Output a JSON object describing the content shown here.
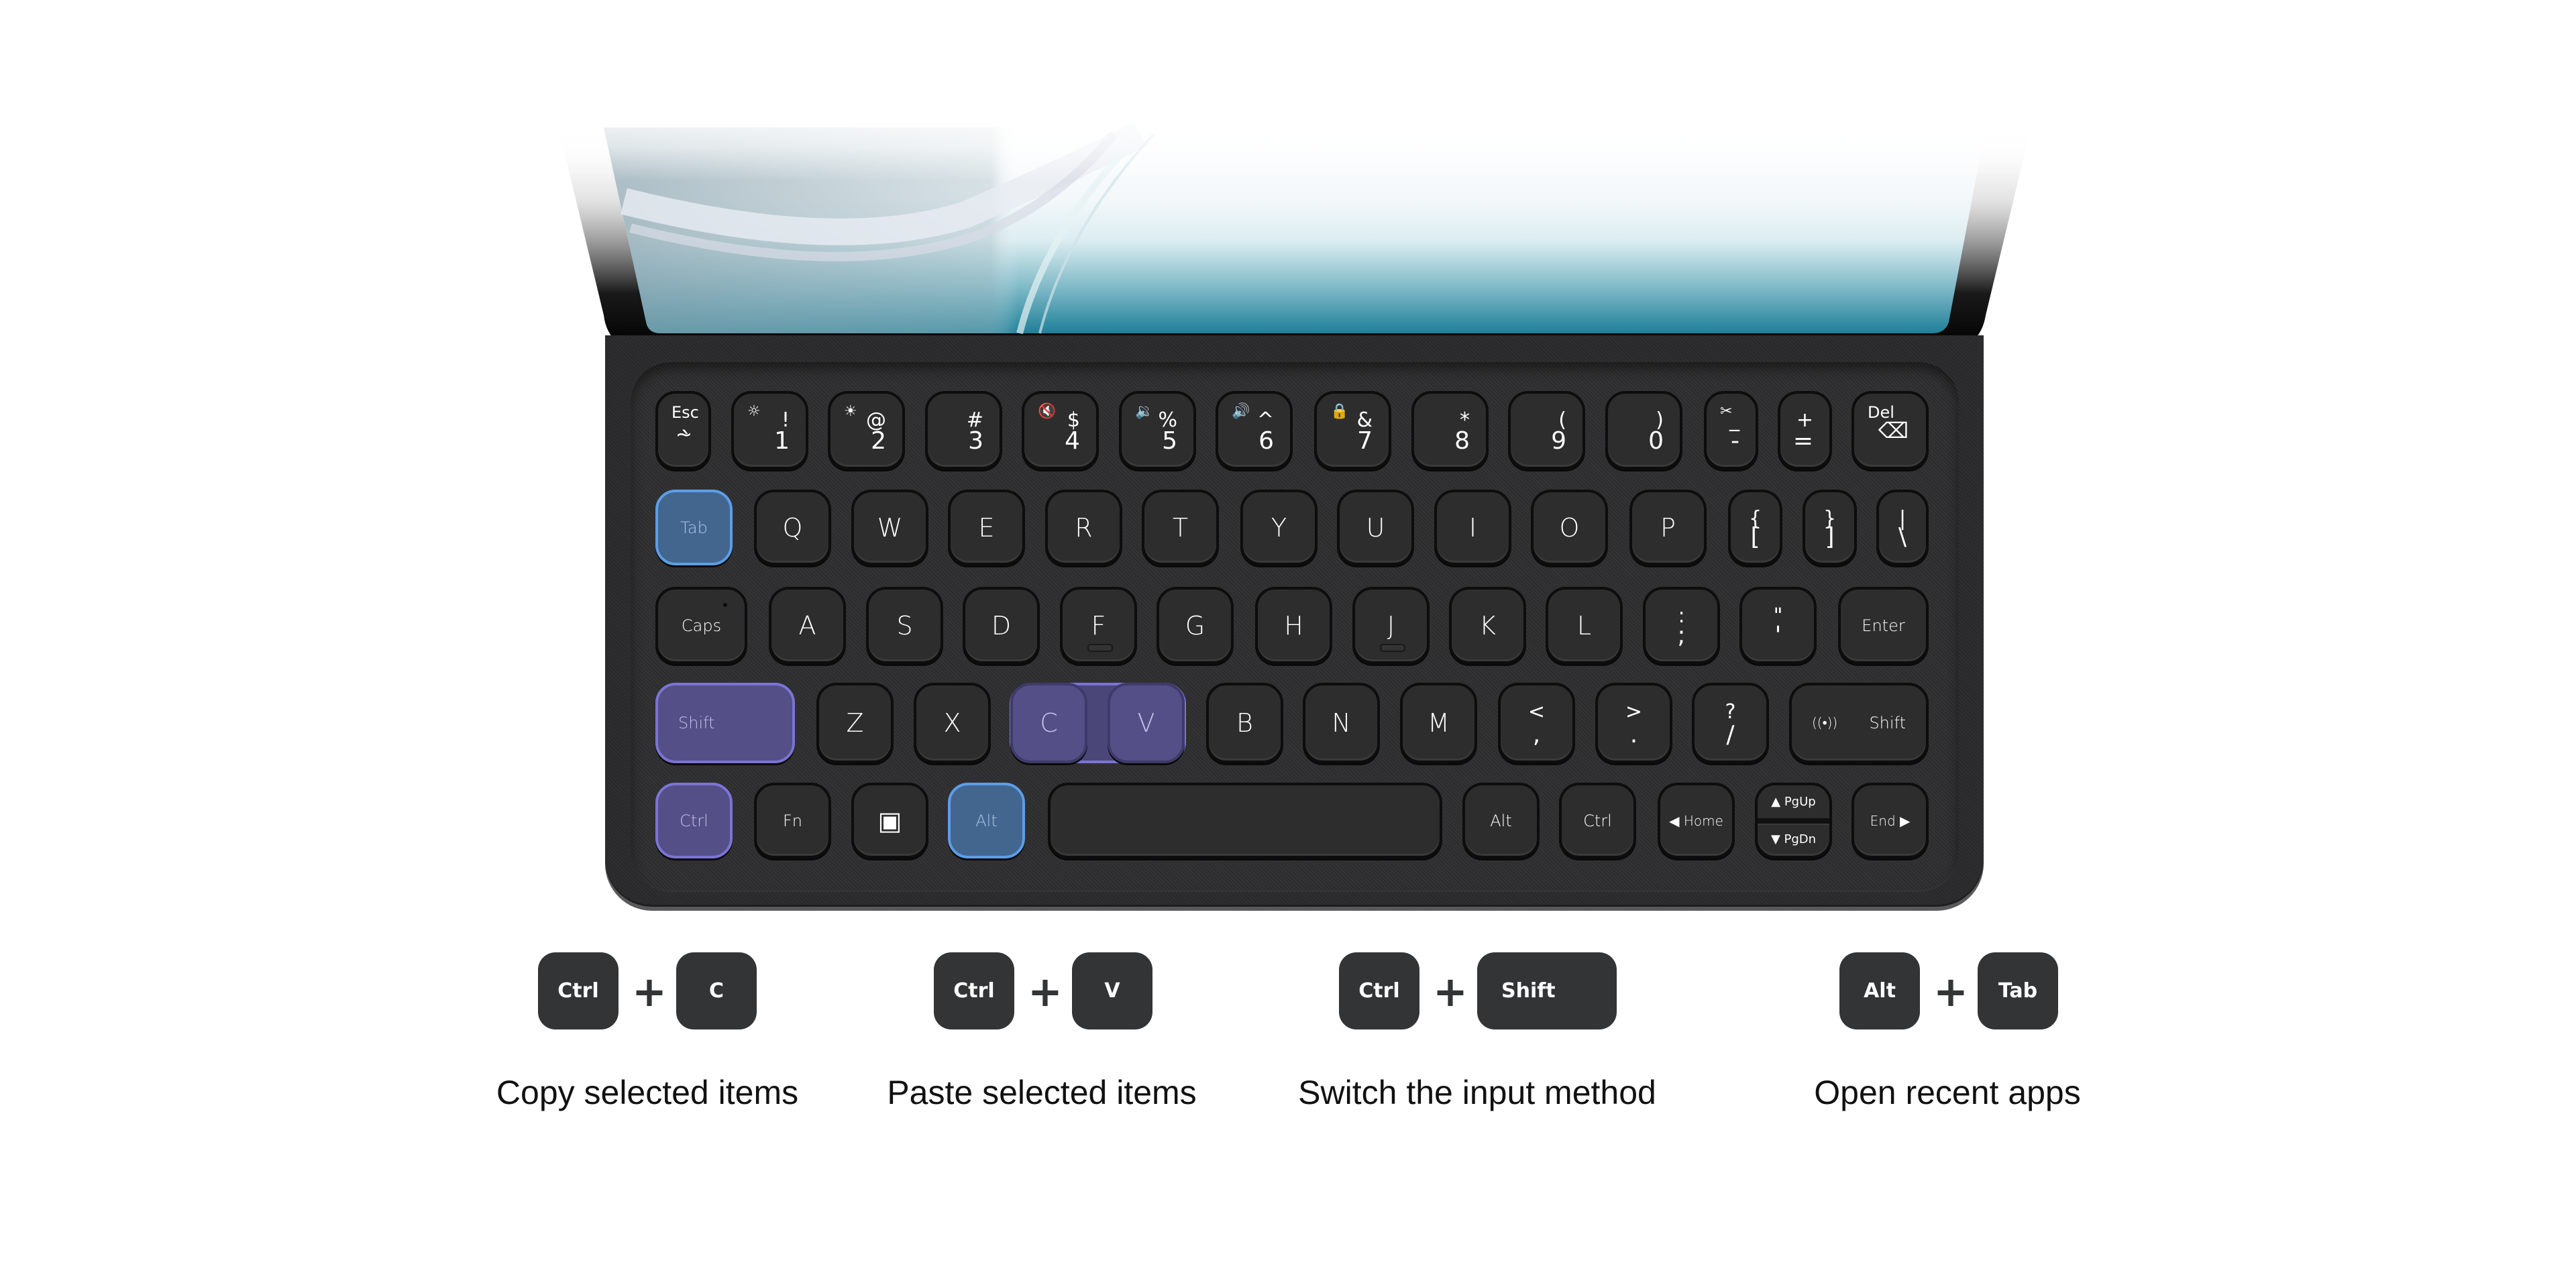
{
  "colors": {
    "highlight_blue_fill": "#43668f",
    "highlight_blue_border": "#5b9ee8",
    "highlight_purple_fill": "#544f86",
    "highlight_purple_border": "#7b74d4",
    "keycap_dark": "#333436"
  },
  "keyboard": {
    "rows": [
      [
        {
          "id": "esc",
          "label": "Esc",
          "shift": "~",
          "base": "`",
          "type": "esc"
        },
        {
          "id": "1",
          "fn": "☼",
          "shift": "!",
          "base": "1",
          "type": "num",
          "fn_name": "brightness-down-icon"
        },
        {
          "id": "2",
          "fn": "☀",
          "shift": "@",
          "base": "2",
          "type": "num",
          "fn_name": "brightness-up-icon"
        },
        {
          "id": "3",
          "shift": "#",
          "base": "3",
          "type": "num"
        },
        {
          "id": "4",
          "fn": "🔇",
          "shift": "$",
          "base": "4",
          "type": "num",
          "fn_name": "mute-icon"
        },
        {
          "id": "5",
          "fn": "🔉",
          "shift": "%",
          "base": "5",
          "type": "num",
          "fn_name": "volume-down-icon"
        },
        {
          "id": "6",
          "fn": "🔊",
          "shift": "^",
          "base": "6",
          "type": "num",
          "fn_name": "volume-up-icon"
        },
        {
          "id": "7",
          "fn": "🔒",
          "shift": "&",
          "base": "7",
          "type": "num",
          "fn_name": "lock-icon"
        },
        {
          "id": "8",
          "shift": "*",
          "base": "8",
          "type": "num"
        },
        {
          "id": "9",
          "shift": "(",
          "base": "9",
          "type": "num"
        },
        {
          "id": "0",
          "shift": ")",
          "base": "0",
          "type": "num"
        },
        {
          "id": "minus",
          "fn": "✂",
          "shift": "_",
          "base": "-",
          "type": "num",
          "fn_name": "screenshot-icon"
        },
        {
          "id": "equal",
          "shift": "+",
          "base": "=",
          "type": "num"
        },
        {
          "id": "del",
          "label": "Del",
          "icon": "⌫",
          "type": "del"
        }
      ],
      [
        {
          "id": "tab",
          "label": "Tab",
          "type": "word",
          "highlight": "blue"
        },
        {
          "id": "q",
          "label": "Q"
        },
        {
          "id": "w",
          "label": "W"
        },
        {
          "id": "e",
          "label": "E"
        },
        {
          "id": "r",
          "label": "R"
        },
        {
          "id": "t",
          "label": "T"
        },
        {
          "id": "y",
          "label": "Y"
        },
        {
          "id": "u",
          "label": "U"
        },
        {
          "id": "i",
          "label": "I"
        },
        {
          "id": "o",
          "label": "O"
        },
        {
          "id": "p",
          "label": "P"
        },
        {
          "id": "lbracket",
          "shift": "{",
          "base": "[",
          "type": "sym"
        },
        {
          "id": "rbracket",
          "shift": "}",
          "base": "]",
          "type": "sym"
        },
        {
          "id": "backslash",
          "shift": "|",
          "base": "\\",
          "type": "sym"
        }
      ],
      [
        {
          "id": "caps",
          "label": "Caps",
          "type": "word",
          "indicator": true
        },
        {
          "id": "a",
          "label": "A"
        },
        {
          "id": "s",
          "label": "S"
        },
        {
          "id": "d",
          "label": "D"
        },
        {
          "id": "f",
          "label": "F",
          "homing": true
        },
        {
          "id": "g",
          "label": "G"
        },
        {
          "id": "h",
          "label": "H"
        },
        {
          "id": "j",
          "label": "J",
          "homing": true
        },
        {
          "id": "k",
          "label": "K"
        },
        {
          "id": "l",
          "label": "L"
        },
        {
          "id": "semicolon",
          "shift": ":",
          "base": ";",
          "type": "sym"
        },
        {
          "id": "quote",
          "shift": "\"",
          "base": "'",
          "type": "sym"
        },
        {
          "id": "enter",
          "label": "Enter",
          "type": "word"
        }
      ],
      [
        {
          "id": "lshift",
          "label": "Shift",
          "type": "word-left",
          "highlight": "purple"
        },
        {
          "id": "z",
          "label": "Z"
        },
        {
          "id": "x",
          "label": "X"
        },
        {
          "id": "c",
          "label": "C",
          "highlight": "purple-group"
        },
        {
          "id": "v",
          "label": "V",
          "highlight": "purple-group"
        },
        {
          "id": "b",
          "label": "B"
        },
        {
          "id": "n",
          "label": "N"
        },
        {
          "id": "m",
          "label": "M"
        },
        {
          "id": "comma",
          "shift": "<",
          "base": ",",
          "type": "sym"
        },
        {
          "id": "period",
          "shift": ">",
          "base": ".",
          "type": "sym"
        },
        {
          "id": "slash",
          "shift": "?",
          "base": "/",
          "type": "sym"
        },
        {
          "id": "rshift",
          "label": "Shift",
          "icon": "((•))",
          "type": "rshift"
        }
      ],
      [
        {
          "id": "lctrl",
          "label": "Ctrl",
          "type": "word",
          "highlight": "purple"
        },
        {
          "id": "fn",
          "label": "Fn",
          "type": "word"
        },
        {
          "id": "apps",
          "icon": "▣",
          "type": "apps"
        },
        {
          "id": "lalt",
          "label": "Alt",
          "type": "word",
          "highlight": "blue"
        },
        {
          "id": "space",
          "label": "",
          "type": "space"
        },
        {
          "id": "ralt",
          "label": "Alt",
          "type": "word"
        },
        {
          "id": "rctrl",
          "label": "Ctrl",
          "type": "word"
        },
        {
          "id": "home",
          "label": "◀ Home",
          "type": "small"
        },
        {
          "id": "pgupdn",
          "up": "▲ PgUp",
          "down": "▼ PgDn",
          "type": "pg"
        },
        {
          "id": "end",
          "label": "End ▶",
          "type": "small"
        }
      ]
    ]
  },
  "shortcuts": [
    {
      "keys": [
        "Ctrl",
        "C"
      ],
      "plus": "+",
      "description": "Copy selected items"
    },
    {
      "keys": [
        "Ctrl",
        "V"
      ],
      "plus": "+",
      "description": "Paste selected items"
    },
    {
      "keys": [
        "Ctrl",
        "Shift"
      ],
      "plus": "+",
      "description": "Switch the input method"
    },
    {
      "keys": [
        "Alt",
        "Tab"
      ],
      "plus": "+",
      "description": "Open recent apps"
    }
  ]
}
